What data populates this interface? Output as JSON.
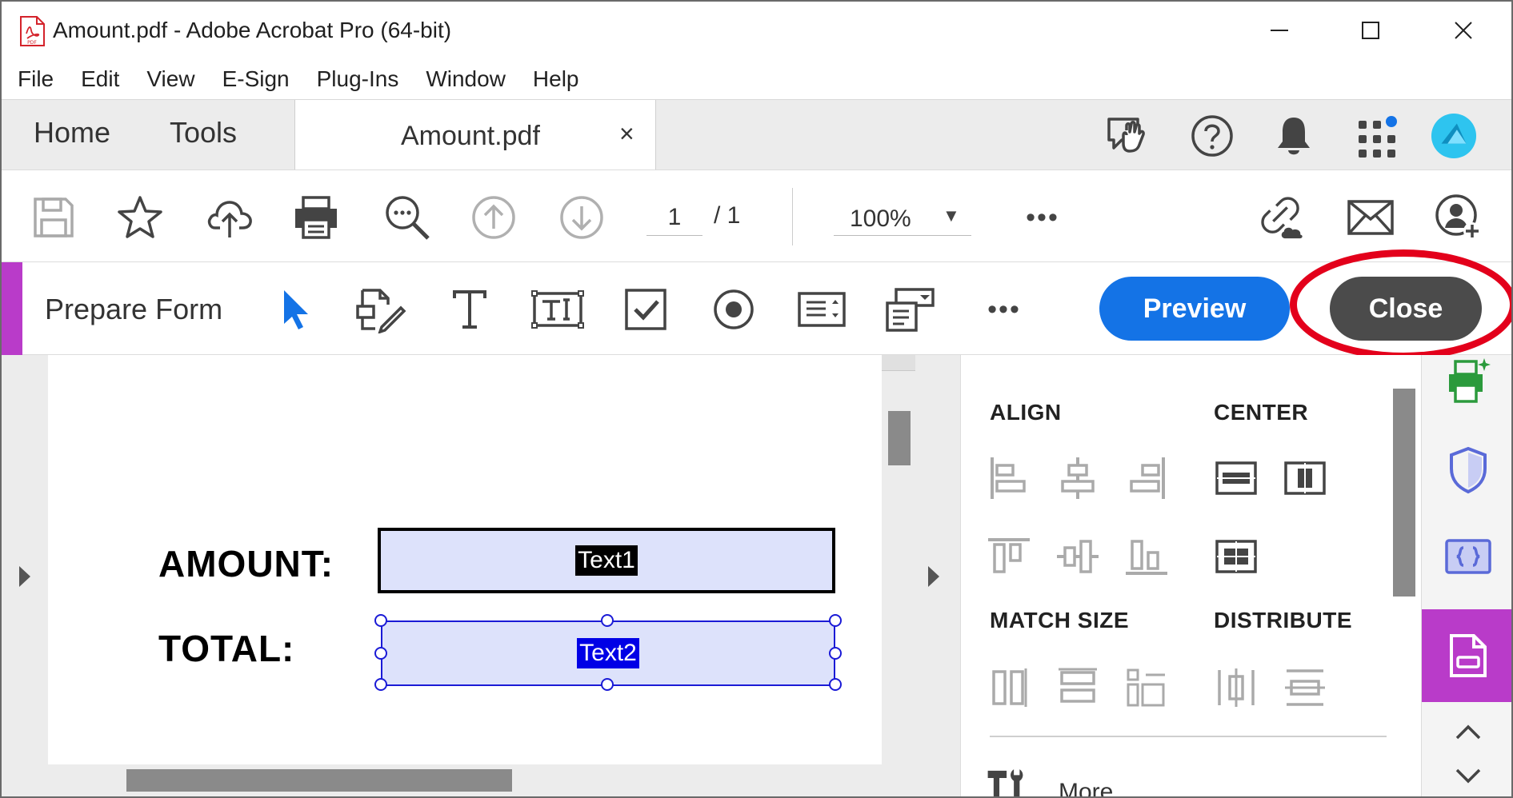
{
  "window": {
    "title": "Amount.pdf - Adobe Acrobat Pro (64-bit)"
  },
  "menu": [
    "File",
    "Edit",
    "View",
    "E-Sign",
    "Plug-Ins",
    "Window",
    "Help"
  ],
  "tabs": {
    "home": "Home",
    "tools": "Tools",
    "document": "Amount.pdf",
    "close_glyph": "×"
  },
  "toolbar": {
    "page_current": "1",
    "page_total": "/  1",
    "zoom": "100%",
    "zoom_caret": "▼",
    "more": "•••"
  },
  "prepare_form": {
    "title": "Prepare Form",
    "more": "•••",
    "preview_label": "Preview",
    "close_label": "Close"
  },
  "document": {
    "amount_label": "AMOUNT:",
    "total_label": "TOTAL:",
    "field1_name": "Text1",
    "field2_name": "Text2"
  },
  "panel": {
    "align": "ALIGN",
    "center": "CENTER",
    "match_size": "MATCH SIZE",
    "distribute": "DISTRIBUTE",
    "more": "More"
  },
  "colors": {
    "accent_purple": "#b93bc9",
    "preview_blue": "#1473e6",
    "close_gray": "#4b4b4b",
    "highlight_red": "#e3001b",
    "field_fill": "#dde2fb"
  }
}
